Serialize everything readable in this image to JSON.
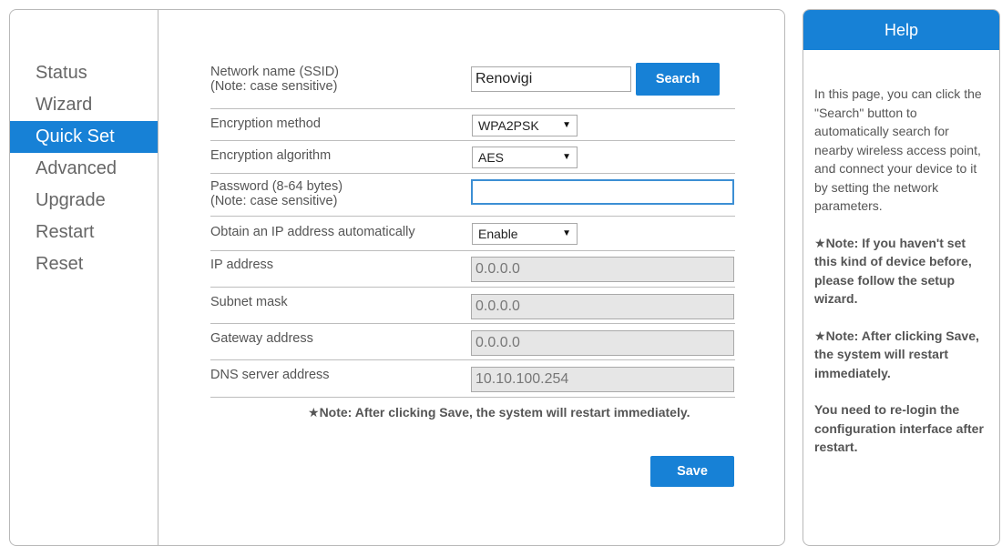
{
  "nav": {
    "items": [
      {
        "label": "Status"
      },
      {
        "label": "Wizard"
      },
      {
        "label": "Quick Set",
        "active": true
      },
      {
        "label": "Advanced"
      },
      {
        "label": "Upgrade"
      },
      {
        "label": "Restart"
      },
      {
        "label": "Reset"
      }
    ]
  },
  "form": {
    "ssid": {
      "label": "Network name (SSID)",
      "sublabel": "(Note: case sensitive)",
      "value": "Renovigi",
      "search_button": "Search"
    },
    "encryption_method": {
      "label": "Encryption method",
      "value": "WPA2PSK"
    },
    "encryption_algorithm": {
      "label": "Encryption algorithm",
      "value": "AES"
    },
    "password": {
      "label": "Password (8-64 bytes)",
      "sublabel": "(Note: case sensitive)",
      "value": ""
    },
    "obtain_ip": {
      "label": "Obtain an IP address automatically",
      "value": "Enable"
    },
    "ip_address": {
      "label": "IP address",
      "value": "0.0.0.0"
    },
    "subnet_mask": {
      "label": "Subnet mask",
      "value": "0.0.0.0"
    },
    "gateway": {
      "label": "Gateway address",
      "value": "0.0.0.0"
    },
    "dns": {
      "label": "DNS server address",
      "value": "10.10.100.254"
    },
    "note": "Note: After clicking Save, the system will restart immediately.",
    "star": "★",
    "save_button": "Save"
  },
  "help": {
    "title": "Help",
    "intro": "In this page, you can click the \"Search\" button to automatically search for nearby wireless access point, and connect your device to it by setting the network parameters.",
    "note1": "Note: If you haven't set this kind of device before, please follow the setup wizard.",
    "note2": "Note: After clicking Save, the system will restart immediately.",
    "relogin": "You need to re-login the configuration interface after restart.",
    "star": "★"
  },
  "colors": {
    "accent": "#1781d6"
  }
}
